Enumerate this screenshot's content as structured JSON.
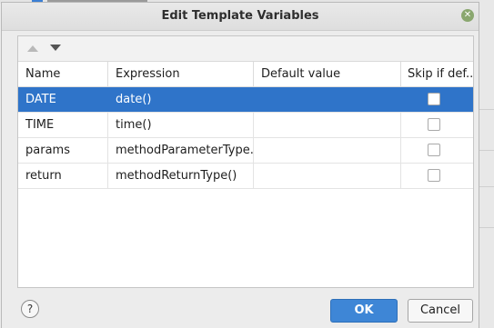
{
  "dialog": {
    "title": "Edit Template Variables",
    "close_icon": "close-icon"
  },
  "toolbar": {
    "move_up_icon": "arrow-up-icon",
    "move_down_icon": "arrow-down-icon"
  },
  "table": {
    "headers": [
      "Name",
      "Expression",
      "Default value",
      "Skip if def..."
    ],
    "rows": [
      {
        "name": "DATE",
        "expression": "date()",
        "default_value": "",
        "skip": false,
        "selected": true
      },
      {
        "name": "TIME",
        "expression": "time()",
        "default_value": "",
        "skip": false,
        "selected": false
      },
      {
        "name": "params",
        "expression": "methodParameterType...",
        "default_value": "",
        "skip": false,
        "selected": false
      },
      {
        "name": "return",
        "expression": "methodReturnType()",
        "default_value": "",
        "skip": false,
        "selected": false
      }
    ]
  },
  "buttons": {
    "help_label": "?",
    "ok_label": "OK",
    "cancel_label": "Cancel"
  },
  "colors": {
    "selection": "#2f74c9",
    "primary_button": "#3e86d6",
    "close_button": "#8aa76f"
  }
}
